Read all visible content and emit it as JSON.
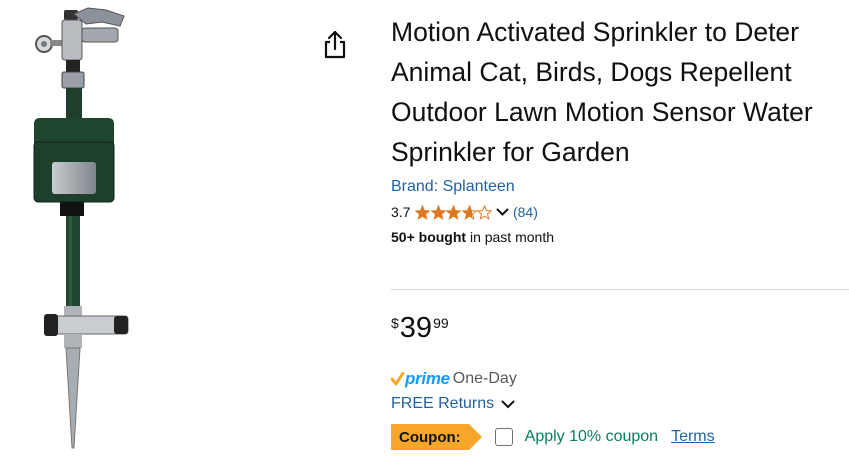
{
  "product": {
    "title": "Motion Activated Sprinkler to Deter Animal Cat, Birds, Dogs Repellent Outdoor Lawn Motion Sensor Water Sprinkler for Garden",
    "brand_label": "Brand: Splanteen",
    "rating": "3.7",
    "stars_value": 3.7,
    "review_count": "(84)",
    "bought_bold": "50+ bought",
    "bought_rest": " in past month"
  },
  "price": {
    "symbol": "$",
    "whole": "39",
    "fraction": "99"
  },
  "delivery": {
    "prime_label": "prime",
    "one_day": "One-Day",
    "free_returns": "FREE Returns"
  },
  "coupon": {
    "badge": "Coupon:",
    "apply": "Apply 10% coupon",
    "terms": "Terms"
  },
  "colors": {
    "link": "#2162a1",
    "star": "#de7921",
    "coupon_badge": "#f7a629",
    "coupon_text": "#067d62",
    "prime_blue": "#1399ff",
    "prime_check": "#f7a629"
  },
  "icons": {
    "share": "share-icon",
    "star": "star-icon",
    "chevron": "chevron-down-icon",
    "prime_check": "prime-check-icon"
  }
}
